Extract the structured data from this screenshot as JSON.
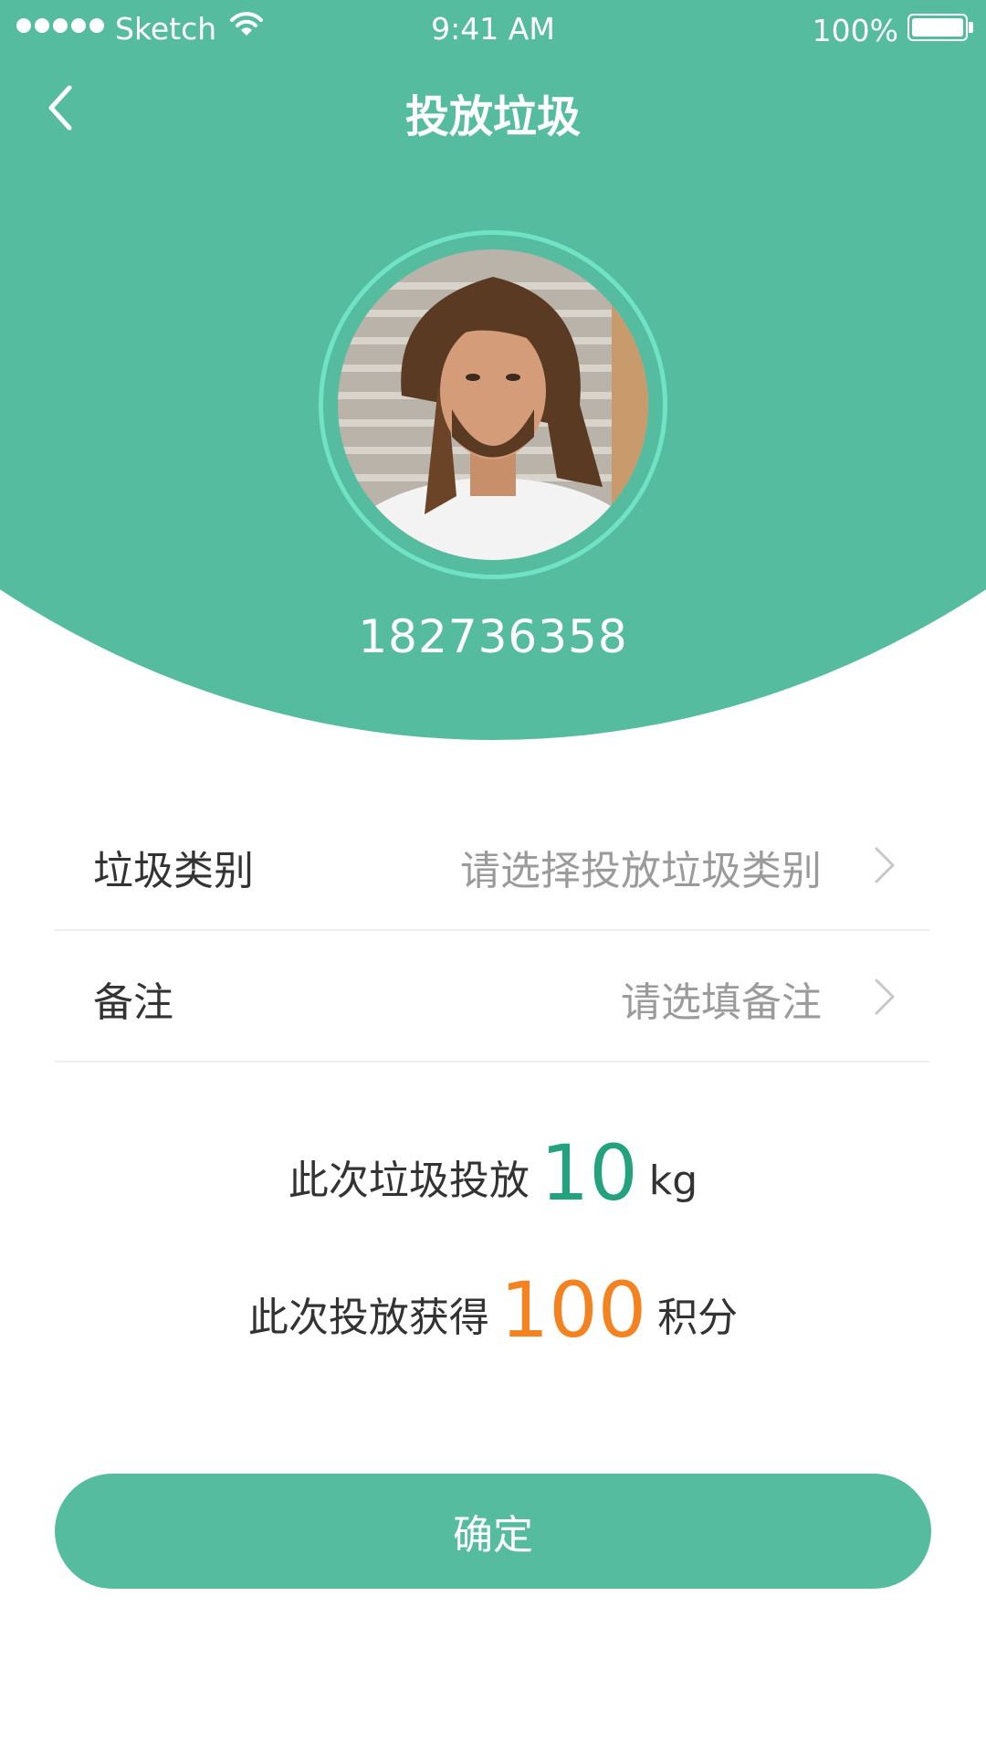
{
  "status_bar": {
    "carrier": "Sketch",
    "time": "9:41 AM",
    "battery": "100%"
  },
  "nav": {
    "title": "投放垃圾",
    "back_icon": "chevron-left-icon"
  },
  "user": {
    "avatar": "user-avatar-photo",
    "phone": "182736358"
  },
  "form": {
    "category": {
      "label": "垃圾类别",
      "placeholder": "请选择投放垃圾类别"
    },
    "note": {
      "label": "备注",
      "placeholder": "请选填备注"
    }
  },
  "summary": {
    "weight_prefix": "此次垃圾投放",
    "weight_value": "10",
    "weight_unit": "kg",
    "points_prefix": "此次投放获得",
    "points_value": "100",
    "points_unit": "积分"
  },
  "confirm_label": "确定",
  "colors": {
    "primary": "#56bc9f",
    "avatar_ring": "#6fe3c3",
    "weight_accent": "#24a17e",
    "points_accent": "#f58220"
  }
}
